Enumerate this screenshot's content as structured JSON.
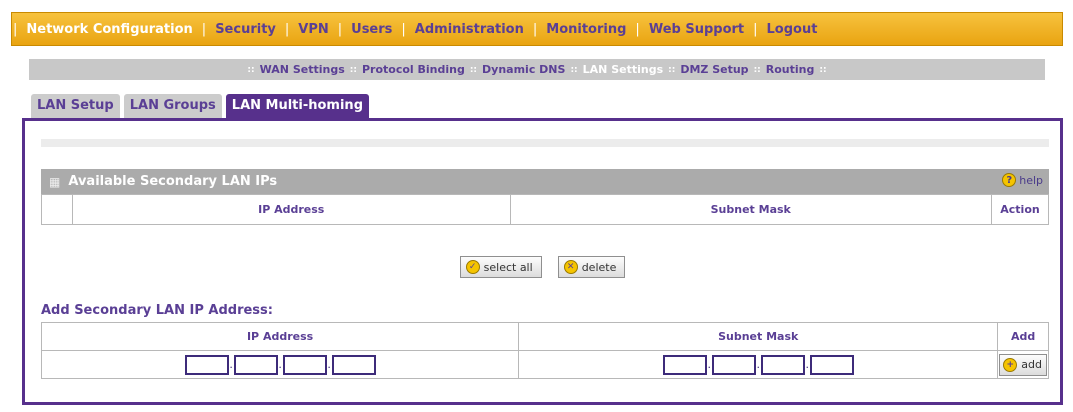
{
  "topnav": {
    "items": [
      {
        "label": "Network Configuration",
        "active": true
      },
      {
        "label": "Security"
      },
      {
        "label": "VPN"
      },
      {
        "label": "Users"
      },
      {
        "label": "Administration"
      },
      {
        "label": "Monitoring"
      },
      {
        "label": "Web Support"
      },
      {
        "label": "Logout"
      }
    ]
  },
  "subnav": {
    "items": [
      {
        "label": "WAN Settings"
      },
      {
        "label": "Protocol Binding"
      },
      {
        "label": "Dynamic DNS"
      },
      {
        "label": "LAN Settings",
        "active": true
      },
      {
        "label": "DMZ Setup"
      },
      {
        "label": "Routing"
      }
    ]
  },
  "tabs": [
    {
      "label": "LAN Setup"
    },
    {
      "label": "LAN Groups"
    },
    {
      "label": "LAN Multi-homing",
      "active": true
    }
  ],
  "available": {
    "title": "Available Secondary LAN IPs",
    "help_label": "help",
    "columns": {
      "ip": "IP Address",
      "mask": "Subnet Mask",
      "action": "Action"
    }
  },
  "buttons": {
    "select_all": "select all",
    "delete": "delete",
    "add": "add"
  },
  "add_section": {
    "title": "Add Secondary LAN IP Address:",
    "columns": {
      "ip": "IP Address",
      "mask": "Subnet Mask",
      "add": "Add"
    },
    "ip_octets": [
      "",
      "",
      "",
      ""
    ],
    "mask_octets": [
      "",
      "",
      "",
      ""
    ]
  },
  "colors": {
    "nav_orange": "#e9a411",
    "accent_purple": "#57308c",
    "header_gray": "#ababab"
  }
}
